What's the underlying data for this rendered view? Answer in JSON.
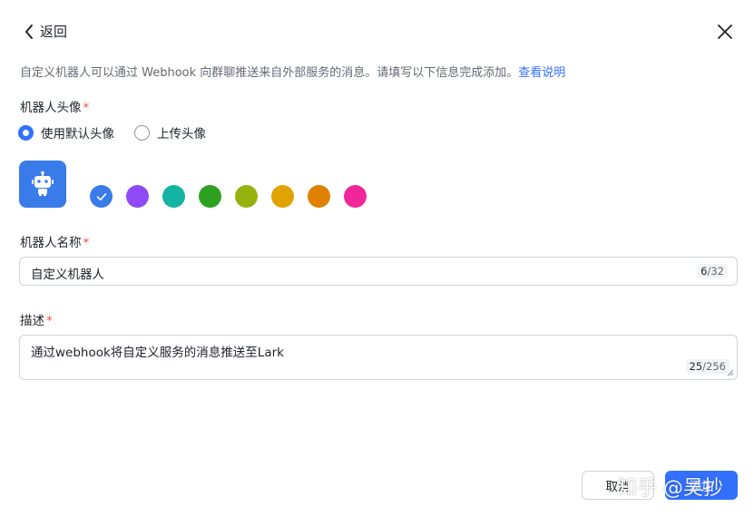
{
  "header": {
    "back_label": "返回",
    "back_icon": "chevron-left-icon",
    "close_icon": "close-icon"
  },
  "intro": {
    "text": "自定义机器人可以通过 Webhook 向群聊推送来自外部服务的消息。请填写以下信息完成添加。",
    "link": "查看说明"
  },
  "avatar_section": {
    "label": "机器人头像",
    "required_mark": "*",
    "options": [
      {
        "label": "使用默认头像",
        "checked": true
      },
      {
        "label": "上传头像",
        "checked": false
      }
    ],
    "avatar_icon": "robot-icon",
    "avatar_color": "#3a7bea",
    "colors": [
      "#3a7bea",
      "#8e4bf5",
      "#14b3a3",
      "#2ea121",
      "#95b20e",
      "#e0a300",
      "#e08000",
      "#f0279a"
    ],
    "selected_color_index": 0
  },
  "name_section": {
    "label": "机器人名称",
    "required_mark": "*",
    "value": "自定义机器人",
    "count": "6",
    "max": "/32"
  },
  "desc_section": {
    "label": "描述",
    "required_mark": "*",
    "value": "通过webhook将自定义服务的消息推送至Lark",
    "count": "25",
    "max": "/256"
  },
  "footer": {
    "cancel_label": "取消",
    "add_label": "添加"
  },
  "watermark": "知乎 @吴抄",
  "colors": {
    "accent": "#3370ff",
    "required": "#f54a45"
  }
}
